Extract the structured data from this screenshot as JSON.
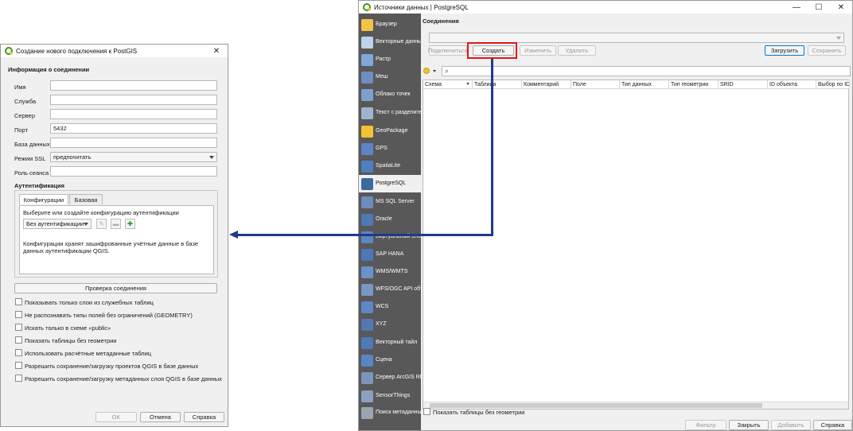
{
  "dialog": {
    "title": "Создание нового подключения к PostGIS",
    "section_info": "Информация о соединении",
    "fields": [
      {
        "label": "Имя",
        "value": ""
      },
      {
        "label": "Служба",
        "value": ""
      },
      {
        "label": "Сервер",
        "value": ""
      },
      {
        "label": "Порт",
        "value": "5432"
      },
      {
        "label": "База данных",
        "value": ""
      },
      {
        "label": "Режим SSL",
        "value": "предпочитать"
      },
      {
        "label": "Роль сеанса",
        "value": ""
      }
    ],
    "auth_title": "Аутентификация",
    "tabs": [
      "Конфигурации",
      "Базовая"
    ],
    "auth_prompt": "Выберите или создайте конфигурацию аутентификации",
    "auth_combo": "Без аутентификации",
    "auth_note_line1": "Конфигурации хранят зашифрованные учётные данные в базе",
    "auth_note_line2": "данных аутентификации QGIS.",
    "test_button": "Проверка соединения",
    "checkboxes": [
      "Показывать только слои из служебных таблиц",
      "Не распознавать типы полей без ограничений (GEOMETRY)",
      "Искать только в схеме «public»",
      "Показать таблицы без геометрии",
      "Использовать расчётные метаданные таблиц",
      "Разрешить сохранение/загрузку проектов QGIS в базе данных",
      "Разрешить сохранение/загрузку метаданных слоя QGIS в базе данных"
    ],
    "ok": "OK",
    "cancel": "Отмена",
    "help": "Справка"
  },
  "main": {
    "title": "Источники данных | PostgreSQL",
    "minimize": "—",
    "maximize": "☐",
    "close": "✕",
    "sidebar": [
      {
        "label": "Браузер",
        "icon": "folder-icon",
        "color": "#f3c34a"
      },
      {
        "label": "Векторные данные",
        "icon": "vector-icon",
        "color": "#bcd3ea"
      },
      {
        "label": "Растр",
        "icon": "raster-icon",
        "color": "#7fa8d6"
      },
      {
        "label": "Меш",
        "icon": "mesh-icon",
        "color": "#6c8fc0"
      },
      {
        "label": "Облако точек",
        "icon": "point-cloud-icon",
        "color": "#7ea0cf"
      },
      {
        "label": "Текст с разделителями",
        "icon": "csv-icon",
        "color": "#9fb5cf"
      },
      {
        "label": "GeoPackage",
        "icon": "geopackage-icon",
        "color": "#f1c232"
      },
      {
        "label": "GPS",
        "icon": "gps-icon",
        "color": "#5c85c4"
      },
      {
        "label": "SpatiaLite",
        "icon": "spatialite-icon",
        "color": "#4e7fc0"
      },
      {
        "label": "PostgreSQL",
        "icon": "postgresql-icon",
        "color": "#3c6aa0"
      },
      {
        "label": "MS SQL Server",
        "icon": "mssql-icon",
        "color": "#6d8cbd"
      },
      {
        "label": "Oracle",
        "icon": "oracle-icon",
        "color": "#4d79b5"
      },
      {
        "label": "Виртуальный слой",
        "icon": "virtual-layer-icon",
        "color": "#5b86c4"
      },
      {
        "label": "SAP HANA",
        "icon": "sap-hana-icon",
        "color": "#4a78b8"
      },
      {
        "label": "WMS/WMTS",
        "icon": "wms-icon",
        "color": "#6a92c9"
      },
      {
        "label": "WFS/OGC API объекты",
        "icon": "wfs-icon",
        "color": "#7897c4"
      },
      {
        "label": "WCS",
        "icon": "wcs-icon",
        "color": "#5d88c4"
      },
      {
        "label": "XYZ",
        "icon": "xyz-icon",
        "color": "#5277b2"
      },
      {
        "label": "Векторный тайл",
        "icon": "vector-tile-icon",
        "color": "#4f79b7"
      },
      {
        "label": "Сцена",
        "icon": "scene-icon",
        "color": "#5a85c2"
      },
      {
        "label": "Сервер ArcGIS REST",
        "icon": "arcgis-icon",
        "color": "#7d96b8"
      },
      {
        "label": "SensorThings",
        "icon": "sensorthings-icon",
        "color": "#8aa1c1"
      },
      {
        "label": "Поиск метаданных",
        "icon": "metadata-search-icon",
        "color": "#9aa5b3"
      }
    ],
    "connections_title": "Соединения",
    "buttons": {
      "connect": "Подключиться",
      "create": "Создать",
      "edit": "Изменить",
      "remove": "Удалить",
      "load": "Загрузить",
      "save": "Сохранить"
    },
    "columns": [
      "Схема",
      "Таблица",
      "Комментарий",
      "Поле",
      "Тип данных",
      "Тип геометрии",
      "SRID",
      "ID объекта",
      "Выбор по ID"
    ],
    "show_no_geom": "Показать таблицы без геометрии",
    "footer": {
      "filter": "Фильтр",
      "close": "Закрыть",
      "add": "Добавить",
      "help": "Справка"
    }
  },
  "colors": {
    "accent_red": "#e01818",
    "arrow_blue": "#1f3a8a",
    "sidebar_bg": "#585858"
  }
}
